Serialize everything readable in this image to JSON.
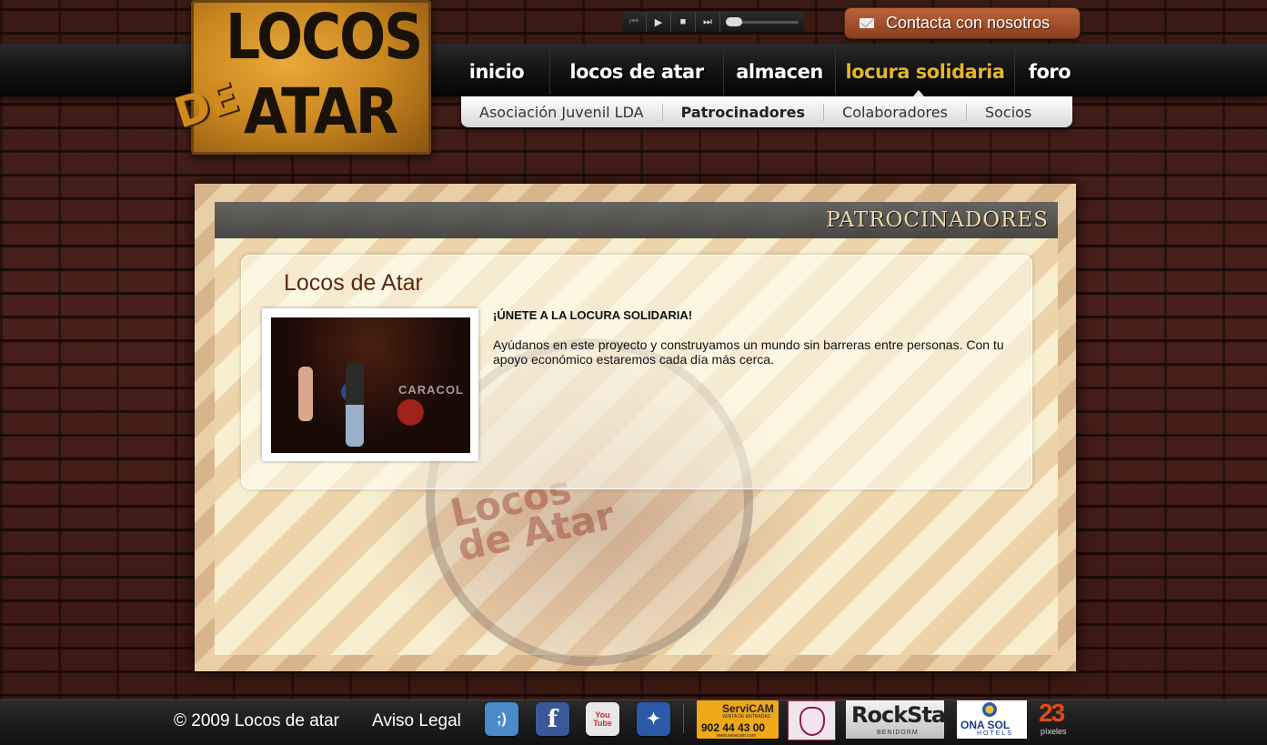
{
  "logo": {
    "line1": "LOCOS",
    "de": "DE",
    "line2": "ATAR"
  },
  "player": {
    "prev": "⏮",
    "play": "▶",
    "stop": "■",
    "next": "⏭"
  },
  "contact": {
    "label": "Contacta con nosotros"
  },
  "nav": {
    "items": [
      "inicio",
      "locos de atar",
      "almacen",
      "locura solidaria",
      "foro"
    ],
    "active": "locura solidaria"
  },
  "subnav": {
    "items": [
      "Asociación Juvenil LDA",
      "Patrocinadores",
      "Colaboradores",
      "Socios"
    ],
    "active": "Patrocinadores"
  },
  "page": {
    "section_title": "PATROCINADORES",
    "heading": "Locos de Atar",
    "photo_sign": "CARACOL",
    "bold_line": "¡ÚNETE A LA LOCURA SOLIDARIA!",
    "paragraph": "Ayúdanos en este proyecto y construyamos un mundo sin barreras entre personas. Con tu apoyo económico estaremos cada día más cerca.",
    "drum_logo_1": "Locos",
    "drum_logo_2": "de Atar"
  },
  "footer": {
    "copyright": "© 2009  Locos de atar",
    "aviso": "Aviso Legal",
    "social": [
      {
        "name": "tuenti",
        "glyph": ";)",
        "color": "#4a8ac9"
      },
      {
        "name": "facebook",
        "glyph": "f",
        "color": "#3b5998"
      },
      {
        "name": "youtube",
        "glyph": "You Tube",
        "color": "#c4302b"
      },
      {
        "name": "myspace",
        "glyph": "✦",
        "color": "#2a5aa8"
      }
    ],
    "sponsors": {
      "servicam": {
        "name": "ServiCAM",
        "sub": "VENTA DE ENTRADAS",
        "phone": "902 44 43 00",
        "url": "www.servicam.com"
      },
      "rockstar": {
        "name": "RockStar",
        "sub": "BENIDORM"
      },
      "onasol": {
        "name": "ONA SOL",
        "sub": "HOTELS"
      },
      "pixeles": {
        "num": "23",
        "sub": "píxeles"
      }
    }
  }
}
